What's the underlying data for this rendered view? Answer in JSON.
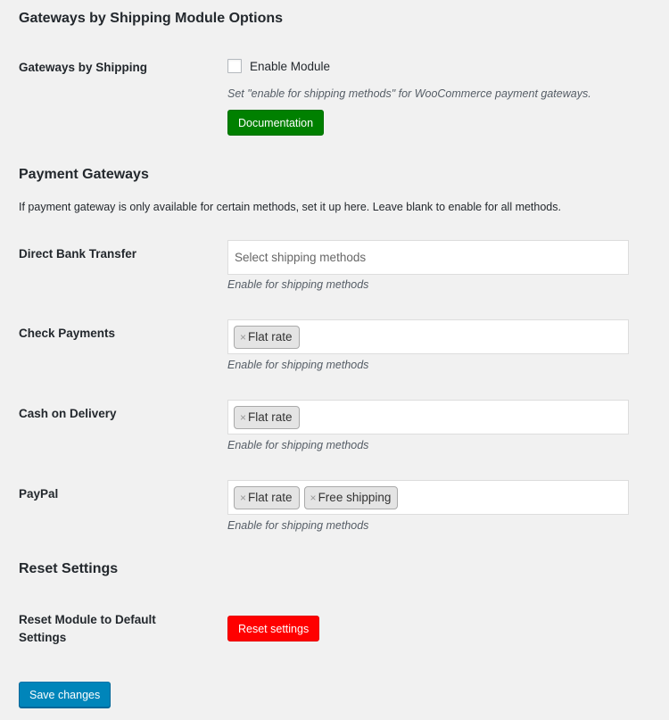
{
  "module_options": {
    "title": "Gateways by Shipping Module Options",
    "row_label": "Gateways by Shipping",
    "enable_checkbox": {
      "label": "Enable Module",
      "checked": false
    },
    "description": "Set \"enable for shipping methods\" for WooCommerce payment gateways.",
    "documentation_button": "Documentation",
    "colors": {
      "documentation_button": "#008000"
    }
  },
  "payment_gateways": {
    "title": "Payment Gateways",
    "intro": "If payment gateway is only available for certain methods, set it up here. Leave blank to enable for all methods.",
    "placeholder": "Select shipping methods",
    "field_description": "Enable for shipping methods",
    "remove_icon": "×",
    "gateways": [
      {
        "label": "Direct Bank Transfer",
        "selected": []
      },
      {
        "label": "Check Payments",
        "selected": [
          "Flat rate"
        ]
      },
      {
        "label": "Cash on Delivery",
        "selected": [
          "Flat rate"
        ]
      },
      {
        "label": "PayPal",
        "selected": [
          "Flat rate",
          "Free shipping"
        ]
      }
    ]
  },
  "reset_settings": {
    "title": "Reset Settings",
    "row_label_line1": "Reset Module to Default",
    "row_label_line2": "Settings",
    "reset_button": "Reset settings",
    "colors": {
      "reset_button": "#ff0000"
    }
  },
  "footer": {
    "save_button": "Save changes",
    "colors": {
      "save_button": "#0085ba"
    }
  }
}
